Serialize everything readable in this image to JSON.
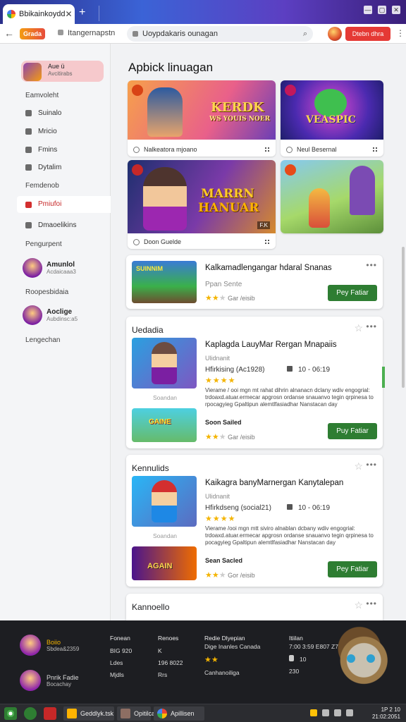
{
  "browser": {
    "tab_title": "Bbikainkoydd",
    "tab_close": "✕",
    "new_tab": "+",
    "back": "←",
    "logo_text": "Grada",
    "page_label": "Itangernapstn",
    "address": "Uoypdakaris ounagan",
    "signin_label": "Dtebn dhra",
    "kebab": "⋮",
    "window_controls": [
      "—",
      "▢",
      "✕"
    ]
  },
  "sidebar": {
    "account": {
      "name": "Aue ü",
      "sub": "Avcitirabs"
    },
    "section1": "Eamvoleht",
    "items1": [
      {
        "label": "Suinalo",
        "icon": "home-icon"
      },
      {
        "label": "Mricio",
        "icon": "music-icon"
      },
      {
        "label": "Fmins",
        "icon": "film-icon"
      },
      {
        "label": "Dytalim",
        "icon": "mic-icon"
      }
    ],
    "section2": "Femdenob",
    "active_item": {
      "label": "Pmiufoi",
      "icon": "controller-icon"
    },
    "items2": [
      {
        "label": "Dmaoelikins",
        "icon": "download-icon"
      }
    ],
    "section3": "Pengurpent",
    "friends": [
      {
        "name": "Amunlol",
        "status": "Acdaicaaa3"
      },
      {
        "name": "Aoclige",
        "status": "Aubdinsc:a5"
      }
    ],
    "section4": "Roopesbidaia",
    "section5": "Lengechan"
  },
  "main": {
    "heading": "Apbick linuagan",
    "tiles": [
      {
        "art_text": "KERDK",
        "art_sub": "WS YOUIS NOER",
        "caption": "Nalkeatora mjoano"
      },
      {
        "art_text": "VEASPIC",
        "caption": "Neul Besernal"
      },
      {
        "art_text": "MARRN",
        "art_sub": "HANUAR",
        "corner": "F.K",
        "caption": "Doon Guelde"
      },
      {
        "art_text": "",
        "caption": ""
      }
    ],
    "featured": {
      "thumb_text": "SUINNIM",
      "name": "Kalkamadlengangar hdaral Snanas",
      "sub": "Ppan Sente",
      "rating": "Gar /eisib",
      "button": "Pey Fatiar"
    },
    "sections": [
      {
        "title": "Uedadia",
        "game_name": "Kaplagda LauyMar Rergan Mnapaiis",
        "game_sub": "Ulidnanit",
        "meta": "Hfirkising (Ac1928)",
        "date": "10 - 06:19",
        "desc": "Vierame / ooi mgn mt rahat dihrin alnanacn dclany wdiv engogrial: trdoaxd.atuar.ermecar apgrosn ordanse snauanvo tegin qrpinesa to rpocagyieg Gpaltipun alemtlfasiadhar Nanstacan day",
        "thumb_caption": "Soandan",
        "second_thumb_text": "GAINE",
        "label": "Soon Sailed",
        "rating": "Gar /eisib",
        "button": "Puy Fatiar"
      },
      {
        "title": "Kennulids",
        "game_name": "Kaikagra banyMarnergan Kanytalepan",
        "game_sub": "Ulidnanit",
        "meta": "Hfirkdseng (social21)",
        "date": "10 - 06:19",
        "desc": "Vierame /ooi mgn mtt siviro alnablan dcbany wdiv engogrial: trdoaxd.atuar.ermecar apgrosn ordanse snauanvo tegin qrpinesa to pocagyieg Gpaltipun alemtlfasiadhar Nanstacan day",
        "thumb_caption": "Soandan",
        "second_thumb_text": "AGAIN",
        "label": "Sean Sacled",
        "rating": "Gor /eisib",
        "button": "Pey Fatiar"
      },
      {
        "title": "Kannoello"
      }
    ]
  },
  "footer": {
    "profiles": [
      {
        "name": "Boiio",
        "sub": "Sbdea&2359"
      },
      {
        "name": "Pnrik Fadie",
        "sub": "Bocachay"
      }
    ],
    "col1": {
      "h": "Fonean",
      "rows": [
        "BIG 920",
        "Ldes",
        "Mjdls"
      ]
    },
    "col2": {
      "h": "Renoes",
      "rows": [
        "K",
        "196 8022",
        "Rrs"
      ]
    },
    "col3": {
      "h": "Redie Dlyepian",
      "sub": "Dige Inanles Canada",
      "rows": [
        "Canhanoiliga"
      ]
    },
    "col4": {
      "h": "Itiilan",
      "sub": "7:00 3:59 E807 Z70",
      "rows": [
        "10",
        "230"
      ]
    }
  },
  "taskbar": {
    "items": [
      "Geddlyk.tsk",
      "Opitilca",
      "Apillisen"
    ],
    "clock": [
      "1P 2 10",
      "21:02:2051"
    ]
  }
}
